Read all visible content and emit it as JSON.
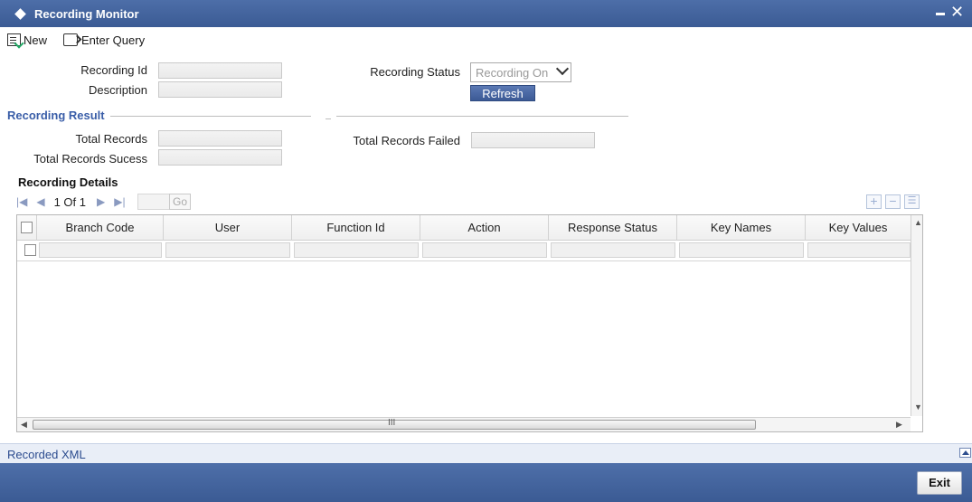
{
  "window": {
    "title": "Recording Monitor"
  },
  "toolbar": {
    "new_label": "New",
    "enter_query_label": "Enter Query"
  },
  "form": {
    "recording_id_label": "Recording Id",
    "description_label": "Description",
    "recording_status_label": "Recording Status",
    "recording_status_value": "Recording On",
    "refresh_label": "Refresh"
  },
  "result": {
    "section_title": "Recording Result",
    "total_records_label": "Total Records",
    "total_records_success_label": "Total Records Sucess",
    "total_records_failed_label": "Total Records Failed"
  },
  "details": {
    "title": "Recording Details",
    "pager_text": "1 Of 1",
    "go_label": "Go",
    "columns": [
      "Branch Code",
      "User",
      "Function Id",
      "Action",
      "Response Status",
      "Key Names",
      "Key Values"
    ],
    "scroll_grip": "III"
  },
  "recorded_xml_label": "Recorded XML",
  "exit_label": "Exit"
}
